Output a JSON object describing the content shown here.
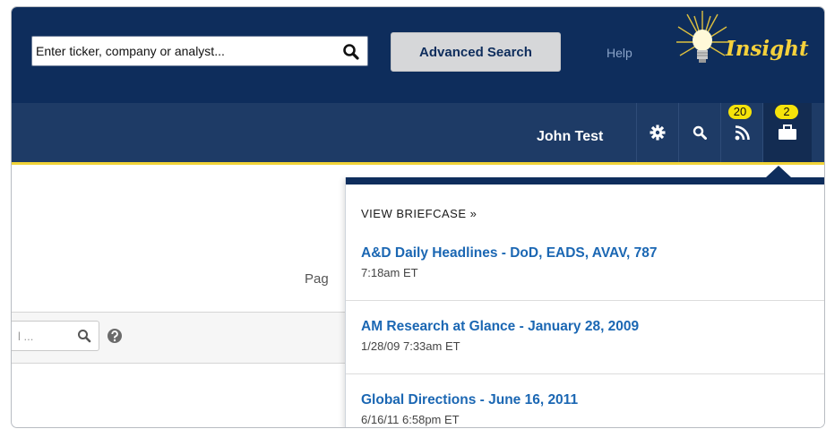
{
  "header": {
    "search_placeholder": "Enter ticker, company or analyst...",
    "advanced_search_label": "Advanced Search",
    "help_label": "Help",
    "logo_text": "Insight",
    "accent_color": "#f5d13c",
    "brand_color": "#0e2d5c"
  },
  "nav": {
    "user_name": "John Test",
    "icons": [
      "gear-icon",
      "search-icon",
      "rss-icon",
      "briefcase-icon"
    ],
    "rss_badge": "20",
    "briefcase_badge": "2"
  },
  "page": {
    "page_label_partial": "Pag",
    "filter_placeholder": "l ..."
  },
  "briefcase": {
    "view_label": "VIEW BRIEFCASE »",
    "items": [
      {
        "title": "A&D Daily Headlines - DoD, EADS, AVAV, 787",
        "time": "7:18am ET"
      },
      {
        "title": "AM Research at Glance - January 28, 2009",
        "time": "1/28/09 7:33am ET"
      },
      {
        "title": "Global Directions - June 16, 2011",
        "time": "6/16/11 6:58pm ET"
      }
    ]
  }
}
